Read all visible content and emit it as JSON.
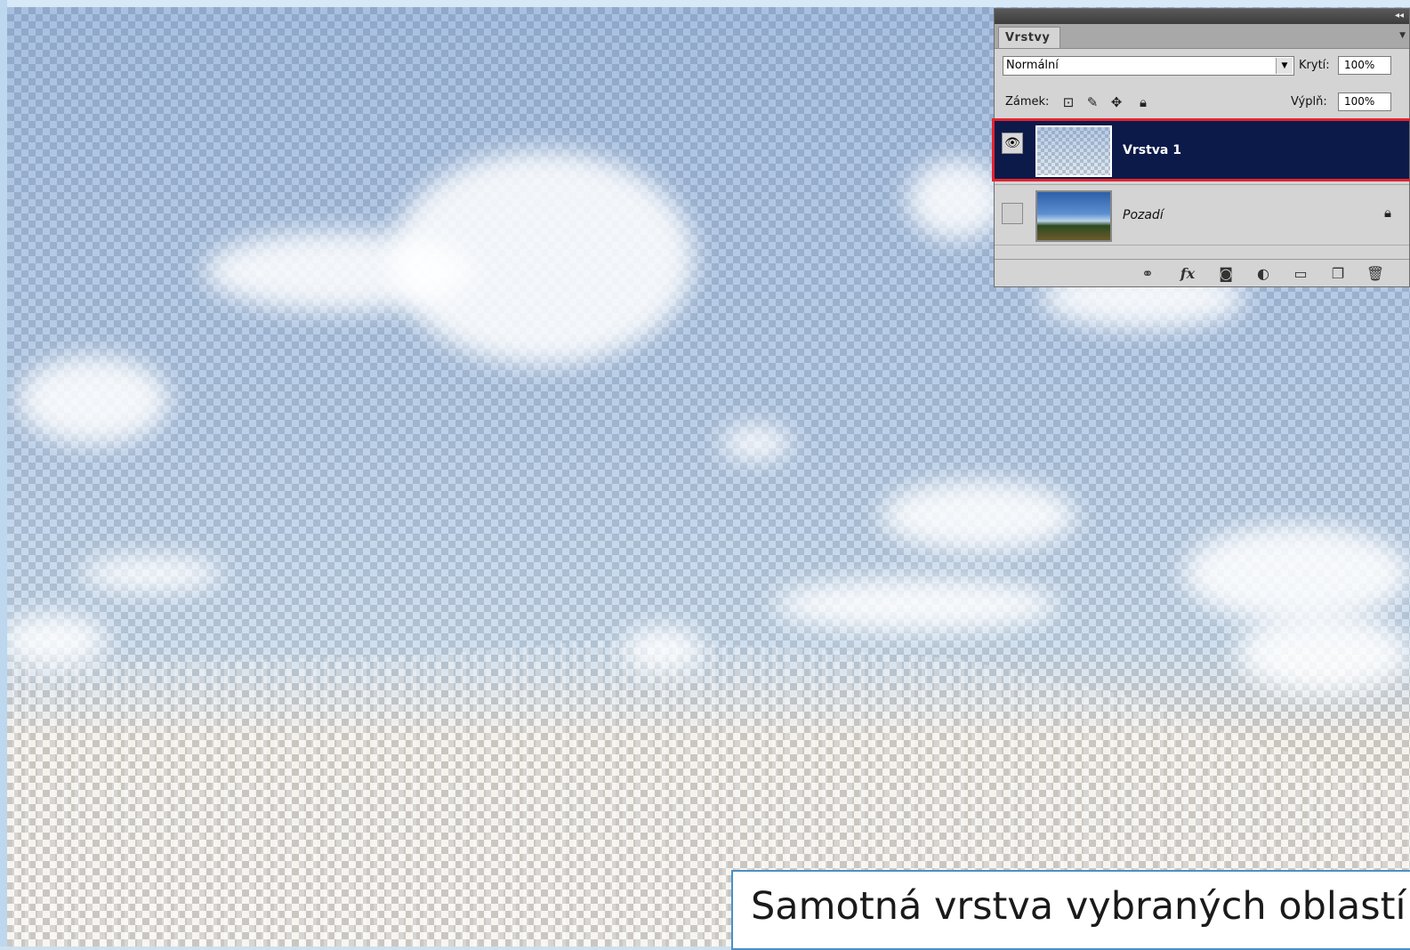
{
  "panel": {
    "tab_label": "Vrstvy",
    "blend_mode": "Normální",
    "opacity_label": "Krytí:",
    "opacity_value": "100%",
    "lock_label": "Zámek:",
    "fill_label": "Výplň:",
    "fill_value": "100%",
    "layers": [
      {
        "name": "Vrstva 1",
        "selected": true,
        "visible": true
      },
      {
        "name": "Pozadí",
        "selected": false,
        "visible": false,
        "locked": true
      }
    ],
    "footer_icons": [
      "link-icon",
      "fx-icon",
      "mask-icon",
      "adjustment-icon",
      "folder-icon",
      "new-layer-icon",
      "trash-icon"
    ]
  },
  "caption": "Samotná vrstva vybraných oblastí",
  "colors": {
    "selection": "#0c1a4a",
    "highlight": "#e3232f",
    "caption_border": "#4a90c8"
  }
}
